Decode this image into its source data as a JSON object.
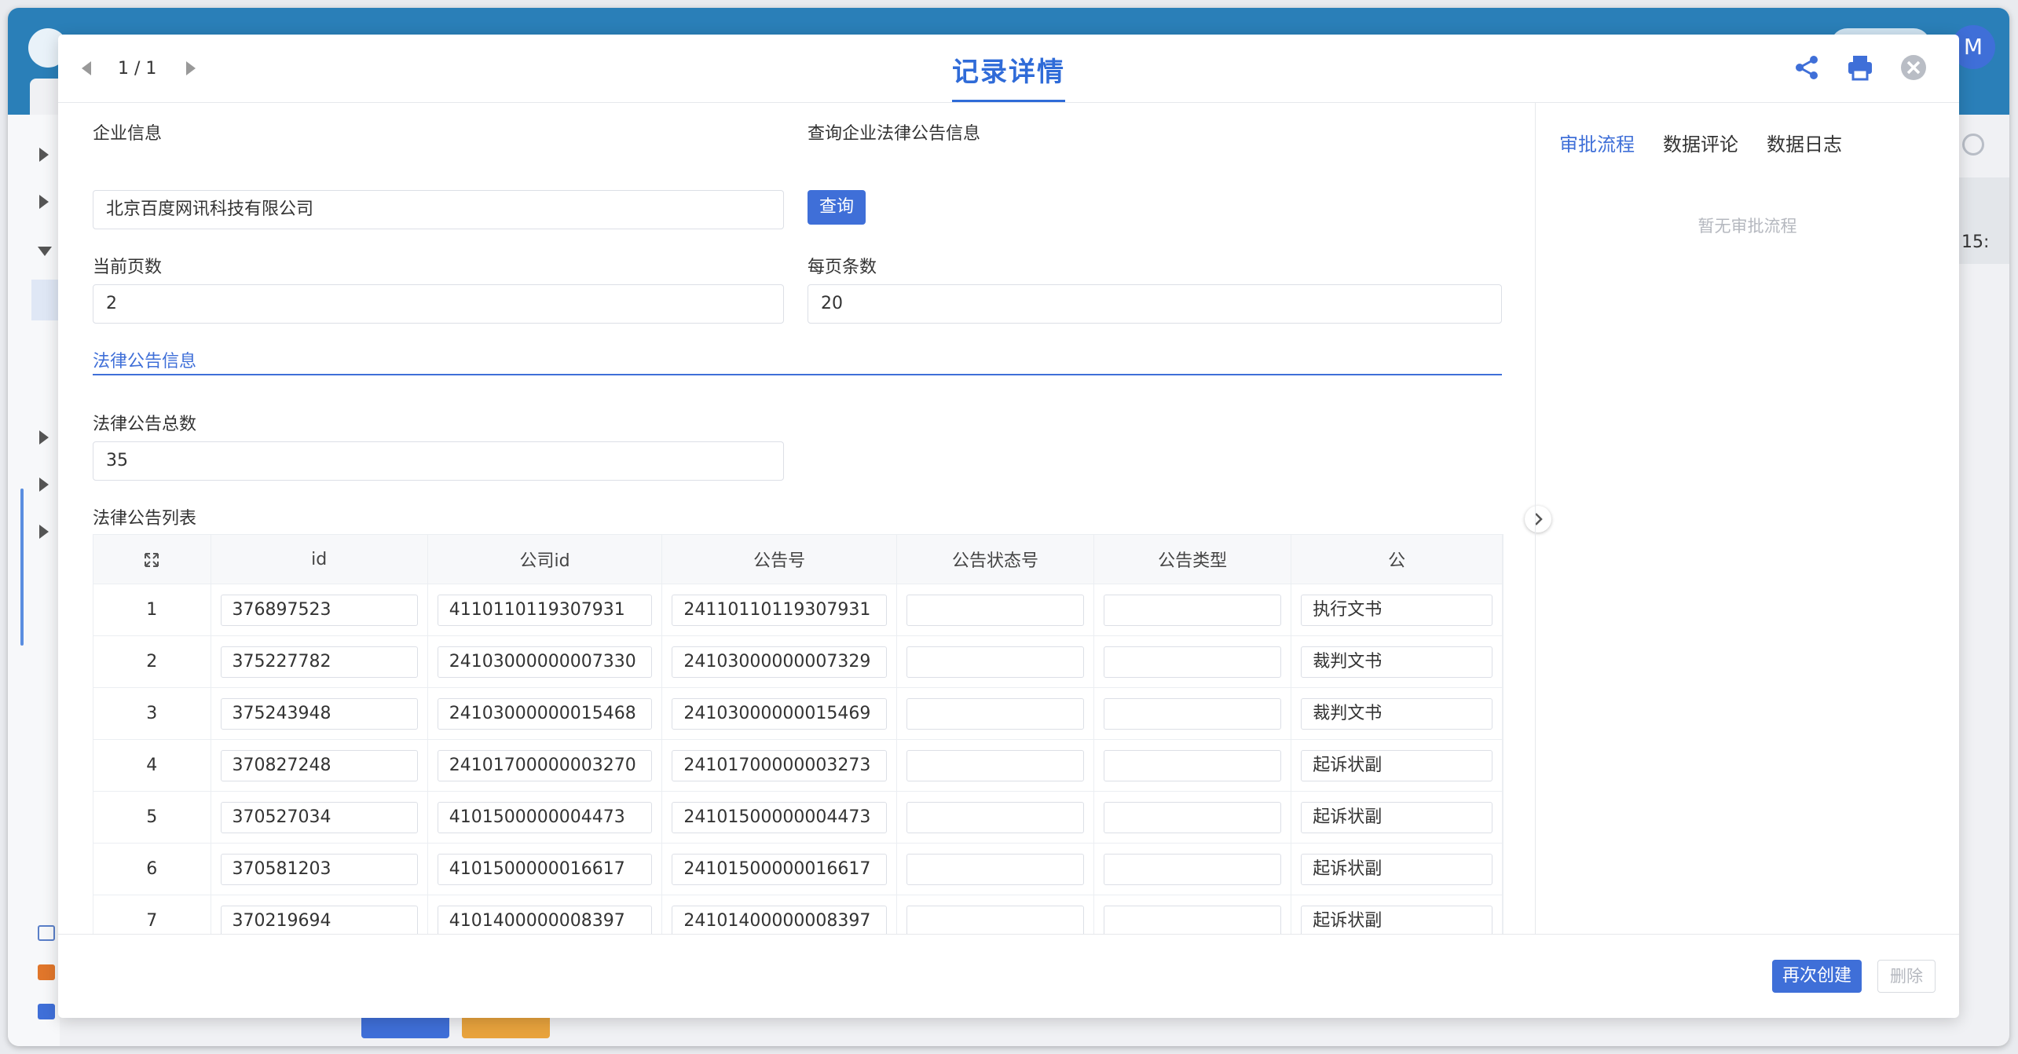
{
  "modal": {
    "pager": "1 / 1",
    "title": "记录详情"
  },
  "form": {
    "company_label": "企业信息",
    "company_value": "北京百度网讯科技有限公司",
    "query_label": "查询企业法律公告信息",
    "query_button": "查询",
    "page_label": "当前页数",
    "page_value": "2",
    "page_size_label": "每页条数",
    "page_size_value": "20",
    "section_title": "法律公告信息",
    "total_label": "法律公告总数",
    "total_value": "35",
    "list_label": "法律公告列表"
  },
  "table": {
    "columns": [
      "id",
      "公司id",
      "公告号",
      "公告状态号",
      "公告类型",
      "公"
    ],
    "rows": [
      {
        "index": "1",
        "id": "376897523",
        "company_id": "4110110119307931",
        "notice_no": "24110110119307931",
        "status_no": "",
        "type": "",
        "extra": "执行文书"
      },
      {
        "index": "2",
        "id": "375227782",
        "company_id": "24103000000007330",
        "notice_no": "24103000000007329",
        "status_no": "",
        "type": "",
        "extra": "裁判文书"
      },
      {
        "index": "3",
        "id": "375243948",
        "company_id": "24103000000015468",
        "notice_no": "24103000000015469",
        "status_no": "",
        "type": "",
        "extra": "裁判文书"
      },
      {
        "index": "4",
        "id": "370827248",
        "company_id": "24101700000003270",
        "notice_no": "24101700000003273",
        "status_no": "",
        "type": "",
        "extra": "起诉状副"
      },
      {
        "index": "5",
        "id": "370527034",
        "company_id": "4101500000004473",
        "notice_no": "24101500000004473",
        "status_no": "",
        "type": "",
        "extra": "起诉状副"
      },
      {
        "index": "6",
        "id": "370581203",
        "company_id": "4101500000016617",
        "notice_no": "24101500000016617",
        "status_no": "",
        "type": "",
        "extra": "起诉状副"
      },
      {
        "index": "7",
        "id": "370219694",
        "company_id": "4101400000008397",
        "notice_no": "24101400000008397",
        "status_no": "",
        "type": "",
        "extra": "起诉状副"
      },
      {
        "index": "",
        "id": "",
        "company_id": "",
        "notice_no": "",
        "status_no": "",
        "type": "",
        "extra": ""
      }
    ]
  },
  "right_panel": {
    "tabs": [
      "审批流程",
      "数据评论",
      "数据日志"
    ],
    "empty_text": "暂无审批流程"
  },
  "footer": {
    "recreate_button": "再次创建",
    "delete_button": "删除"
  },
  "background": {
    "avatar_letter": "M",
    "right_edge_text": "15:"
  },
  "colors": {
    "accent": "#3f6fd8",
    "header_bg": "#2a7fb8"
  }
}
